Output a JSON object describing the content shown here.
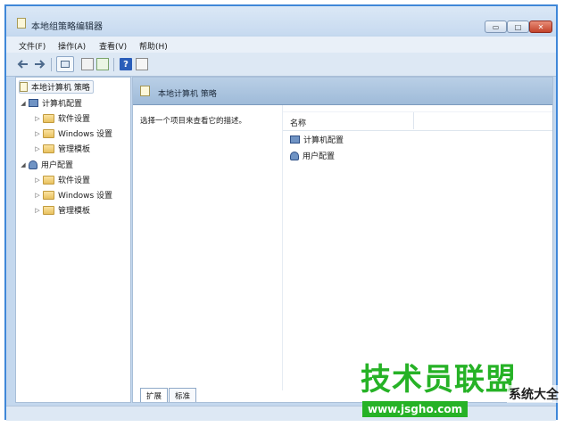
{
  "window": {
    "title": "本地组策略编辑器",
    "controls": {
      "minimize": "▭",
      "maximize": "□",
      "close": "✕"
    }
  },
  "menu": [
    {
      "label": "文件(F)"
    },
    {
      "label": "操作(A)"
    },
    {
      "label": "查看(V)"
    },
    {
      "label": "帮助(H)"
    }
  ],
  "toolbar": {
    "back_icon": "←",
    "forward_icon": "→",
    "help_icon": "?"
  },
  "tree": {
    "root": "本地计算机 策略",
    "computer_config": "计算机配置",
    "computer_children": [
      "软件设置",
      "Windows 设置",
      "管理模板"
    ],
    "user_config": "用户配置",
    "user_children": [
      "软件设置",
      "Windows 设置",
      "管理模板"
    ]
  },
  "right_pane": {
    "header_title": "本地计算机 策略",
    "description": "选择一个项目来查看它的描述。",
    "column_name": "名称",
    "items": [
      "计算机配置",
      "用户配置"
    ],
    "tabs": [
      "扩展",
      "标准"
    ]
  },
  "watermark": {
    "main": "技术员联盟",
    "url": "www.jsgho.com",
    "side": "系统大全"
  },
  "colors": {
    "window_border": "#3f87d8",
    "accent_header": "#b9cfe6",
    "watermark_green": "#26b226"
  }
}
